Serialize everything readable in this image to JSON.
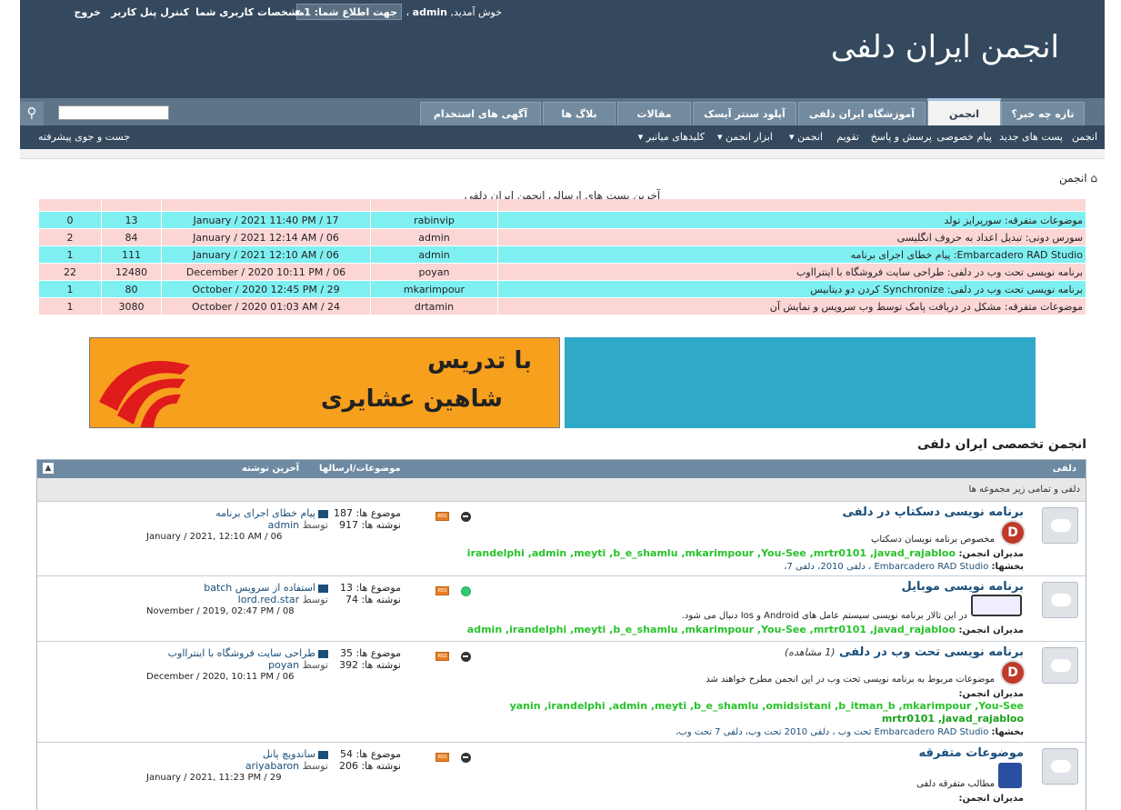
{
  "top": {
    "welcome_prefix": "خوش آمدید,",
    "username": "admin",
    "notice": "جهت اطلاع شما: 1 ▾",
    "links": [
      "مشخصات کاربری شما",
      "کنترل پنل کاربر",
      "خروج"
    ]
  },
  "site_title": "انجمن ایران دلفی",
  "tabs": [
    "تازه چه خبر؟",
    "انجمن",
    "آموزشگاه ایران دلفی",
    "آپلود سنتر آیسک",
    "مقالات",
    "بلاگ ها",
    "آگهی های استخدام"
  ],
  "active_tab": "انجمن",
  "subnav": [
    "انجمن",
    "پست های جدید",
    "پیام خصوصی",
    "پرسش و پاسخ",
    "تقویم",
    "انجمن ▾",
    "ابزار انجمن ▾",
    "کلیدهای میانبر ▾"
  ],
  "advanced_search": "جست و جوی پیشرفته",
  "breadcrumb": "انجمن",
  "latest_title": "آخرین پست هاي ارسالي انجمن ایران دلفی",
  "latest_rows": [
    {
      "title": "موضوعات متفرقه: سورپرایز تولد",
      "user": "rabinvip",
      "date": "January / 2021 11:40 PM / 17",
      "views": "13",
      "replies": "0",
      "color": "cyan"
    },
    {
      "title": "سورس دونی: تبدیل اعداد به حروف انگلیسی",
      "user": "admin",
      "date": "January / 2021 12:14 AM / 06",
      "views": "84",
      "replies": "2",
      "color": "pink"
    },
    {
      "title": "Embarcadero RAD Studio: پیام خطای اجرای برنامه",
      "user": "admin",
      "date": "January / 2021 12:10 AM / 06",
      "views": "111",
      "replies": "1",
      "color": "cyan"
    },
    {
      "title": "برنامه نویسی تحت وب در دلفی: طراحی سایت فروشگاه با اینترااوب",
      "user": "poyan",
      "date": "December / 2020 10:11 PM / 06",
      "views": "12480",
      "replies": "22",
      "color": "pink"
    },
    {
      "title": "برنامه نویسی تحت وب در دلفی: Synchronize کردن دو دیتابیس",
      "user": "mkarimpour",
      "date": "October / 2020 12:45 PM / 29",
      "views": "80",
      "replies": "1",
      "color": "cyan"
    },
    {
      "title": "موضوعات متفرقه: مشکل در دریافت پامک توسط وب سرویس و نمایش آن",
      "user": "drtamin",
      "date": "October / 2020 01:03 AM / 24",
      "views": "3080",
      "replies": "1",
      "color": "pink"
    }
  ],
  "banner": {
    "line1": "با تدریس",
    "line2": "شاهین عشایری"
  },
  "forum_section_title": "انجمن تخصصی ایران دلفی",
  "forum_head": {
    "name": "دلفی",
    "stats": "موضوعات/ارسالها",
    "last": "آخرین نوشته"
  },
  "forum_desc": "دلفی و تمامی زیر مجموعه ها",
  "labels": {
    "mods": "مدیران انجمن:",
    "subs": "بخشها:",
    "topics": "موضوع ها:",
    "posts": "نوشته ها:",
    "by": "توسط"
  },
  "forums": [
    {
      "name": "برنامه نویسی دسکتاپ در دلفی",
      "desc": "مخصوص برنامه نویسان دسکتاپ",
      "mods": "irandelphi ,admin ,meyti ,b_e_shamlu ,mkarimpour ,You-See ,mrtr0101 ,javad_rajabloo",
      "subs": "Embarcadero RAD Studio ، دلفی 2010، دلفی 7،",
      "topics": "187",
      "posts": "917",
      "last_title": "پیام خطای اجرای برنامه",
      "last_user": "admin",
      "last_date": "January / 2021, 12:10 AM / 06"
    },
    {
      "name": "برنامه نویسی موبایل",
      "desc": "در این تالار برنامه نویسی سیستم عامل های Android و Ios دنبال می شود.",
      "mods": "admin ,irandelphi ,meyti ,b_e_shamlu ,mkarimpour ,You-See ,mrtr0101 ,javad_rajabloo",
      "topics": "13",
      "posts": "74",
      "last_title": "استفاده از سرویس batch",
      "last_user": "lord.red.star",
      "last_date": "November / 2019, 02:47 PM / 08"
    },
    {
      "name": "برنامه نویسی تحت وب در دلفی",
      "viewing": "(1 مشاهده)",
      "desc": "موضوعات مربوط به برنامه نویسی تحت وب در این انجمن مطرح خواهند شد",
      "mods1": "yanin ,irandelphi ,admin ,meyti ,b_e_shamlu ,omidsistani ,b_itman_b ,mkarimpour ,You-See",
      "mods2": "mrtr0101 ,javad_rajabloo",
      "subs": "Embarcadero RAD Studio تحت وب ، دلفی 2010 تحت وب، دلفی 7 تحت وب،",
      "topics": "35",
      "posts": "392",
      "last_title": "طراحی سایت فروشگاه با اینترااوب",
      "last_user": "poyan",
      "last_date": "December / 2020, 10:11 PM / 06"
    },
    {
      "name": "موضوعات متفرقه",
      "desc": "مطالب متفرقه دلفی",
      "topics": "54",
      "posts": "206",
      "last_title": "ساندویچ پانل",
      "last_user": "ariyabaron",
      "last_date": "January / 2021, 11:23 PM / 29"
    }
  ],
  "colors": {
    "header_bg": "#34495e",
    "nav_bg": "#5d7489",
    "pink_row": "#fcd5d5",
    "cyan_row": "#7ff0f2",
    "banner_orange": "#f7a01e",
    "banner_blue": "#30a8c8"
  }
}
